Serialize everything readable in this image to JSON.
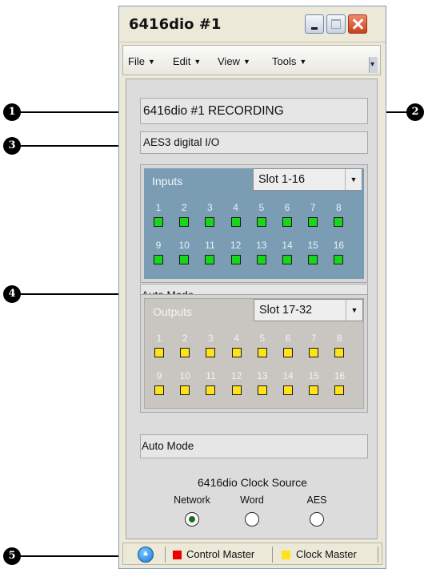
{
  "window": {
    "title": "6416dio #1"
  },
  "menu": [
    {
      "label": "File"
    },
    {
      "label": "Edit"
    },
    {
      "label": "View"
    },
    {
      "label": "Tools"
    }
  ],
  "device": {
    "name_field": "6416dio #1 RECORDING",
    "description": "AES3 digital I/O"
  },
  "inputs": {
    "label": "Inputs",
    "slot": "Slot 1-16",
    "channels_row1": [
      "1",
      "2",
      "3",
      "4",
      "5",
      "6",
      "7",
      "8"
    ],
    "channels_row2": [
      "9",
      "10",
      "11",
      "12",
      "13",
      "14",
      "15",
      "16"
    ],
    "led_color": "#19d61b",
    "mode": "Auto Mode"
  },
  "outputs": {
    "label": "Outputs",
    "slot": "Slot 17-32",
    "channels_row1": [
      "1",
      "2",
      "3",
      "4",
      "5",
      "6",
      "7",
      "8"
    ],
    "channels_row2": [
      "9",
      "10",
      "11",
      "12",
      "13",
      "14",
      "15",
      "16"
    ],
    "led_color": "#ffe21a",
    "mode": "Auto Mode"
  },
  "clock": {
    "title": "6416dio Clock Source",
    "options": [
      {
        "label": "Network",
        "selected": true
      },
      {
        "label": "Word",
        "selected": false
      },
      {
        "label": "AES",
        "selected": false
      }
    ]
  },
  "status": {
    "control_master": "Control Master",
    "control_master_color": "#ee0000",
    "clock_master": "Clock Master",
    "clock_master_color": "#ffe21a"
  },
  "callouts": [
    "1",
    "2",
    "3",
    "4",
    "5"
  ]
}
